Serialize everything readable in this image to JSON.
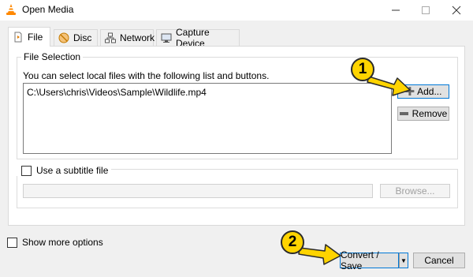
{
  "window": {
    "title": "Open Media",
    "icon": "vlc-cone-icon"
  },
  "tabs": [
    {
      "label": "File",
      "icon": "file-play-icon",
      "active": true
    },
    {
      "label": "Disc",
      "icon": "disc-icon",
      "active": false
    },
    {
      "label": "Network",
      "icon": "network-icon",
      "active": false
    },
    {
      "label": "Capture Device",
      "icon": "capture-device-icon",
      "active": false
    }
  ],
  "file_selection": {
    "legend": "File Selection",
    "description": "You can select local files with the following list and buttons.",
    "files": [
      "C:\\Users\\chris\\Videos\\Sample\\Wildlife.mp4"
    ],
    "add_label": "Add...",
    "remove_label": "Remove"
  },
  "subtitle": {
    "checkbox_label": "Use a subtitle file",
    "checked": false,
    "file_value": "",
    "browse_label": "Browse..."
  },
  "footer": {
    "more_options_label": "Show more options",
    "more_options_checked": false,
    "convert_label": "Convert / Save",
    "cancel_label": "Cancel"
  },
  "annotations": [
    {
      "number": "1",
      "target": "add-button"
    },
    {
      "number": "2",
      "target": "convert-save-button"
    }
  ],
  "colors": {
    "badge": "#ffd400",
    "arrow": "#ffd400",
    "focus_border": "#0078d7"
  }
}
